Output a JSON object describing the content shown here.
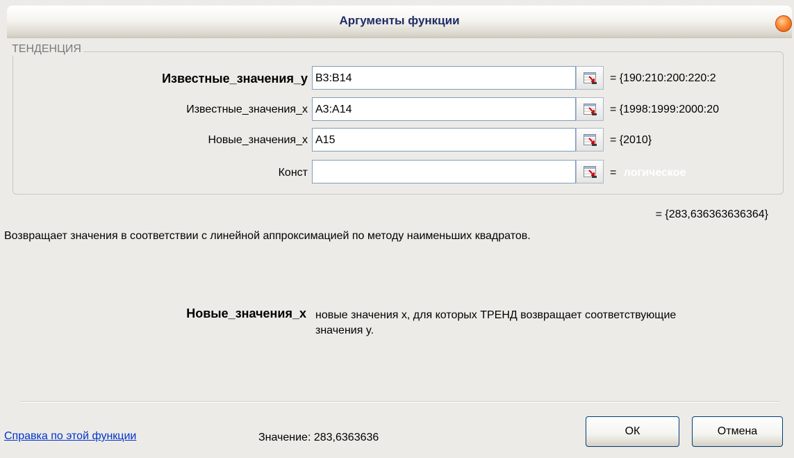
{
  "window": {
    "title": "Аргументы функции"
  },
  "group": {
    "legend": "ТЕНДЕНЦИЯ"
  },
  "args": [
    {
      "label": "Известные_значения_y",
      "input": "B3:B14",
      "value": "= {190:210:200:220:2"
    },
    {
      "label": "Известные_значения_x",
      "input": "A3:A14",
      "value": "= {1998:1999:2000:20"
    },
    {
      "label": "Новые_значения_x",
      "input": "A15",
      "value": "= {2010}"
    },
    {
      "label": "Конст",
      "input": "",
      "value_prefix": "=",
      "value": "логическое"
    }
  ],
  "result": "= {283,636363636364}",
  "description": "Возвращает значения в соответствии с линейной аппроксимацией по методу наименьших квадратов.",
  "help": {
    "arg_name": "Новые_значения_x",
    "text": "новые значения x, для которых ТРЕНД возвращает соответствующие значения y."
  },
  "footer": {
    "help_link": "Справка по этой функции",
    "value_label": "Значение:",
    "value": "283,6363636",
    "ok_label": "ОК",
    "cancel_label": "Отмена"
  },
  "colors": {
    "title_text": "#1f2d66",
    "link": "#0033cc",
    "close_button": "#ff8a33"
  }
}
